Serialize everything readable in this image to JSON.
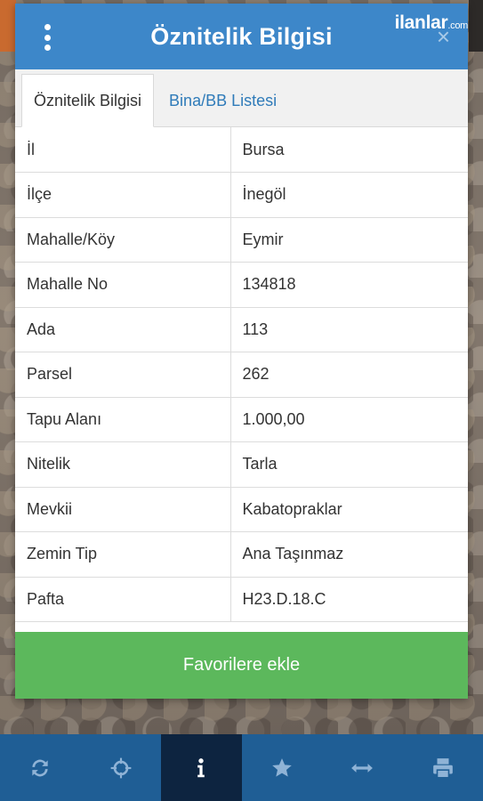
{
  "header": {
    "title": "Öznitelik Bilgisi",
    "brand": "ilanlar",
    "brand_suffix": ".com",
    "close_symbol": "×"
  },
  "tabs": [
    {
      "label": "Öznitelik Bilgisi",
      "active": true
    },
    {
      "label": "Bina/BB Listesi",
      "active": false
    }
  ],
  "attributes": [
    {
      "key": "İl",
      "value": "Bursa"
    },
    {
      "key": "İlçe",
      "value": "İnegöl"
    },
    {
      "key": "Mahalle/Köy",
      "value": "Eymir"
    },
    {
      "key": "Mahalle No",
      "value": "134818"
    },
    {
      "key": "Ada",
      "value": "113"
    },
    {
      "key": "Parsel",
      "value": "262"
    },
    {
      "key": "Tapu Alanı",
      "value": "1.000,00"
    },
    {
      "key": "Nitelik",
      "value": "Tarla"
    },
    {
      "key": "Mevkii",
      "value": "Kabatopraklar"
    },
    {
      "key": "Zemin Tip",
      "value": "Ana Taşınmaz"
    },
    {
      "key": "Pafta",
      "value": "H23.D.18.C"
    }
  ],
  "favorite_button": {
    "label": "Favorilere ekle"
  },
  "bottom_nav": [
    {
      "icon": "refresh-icon",
      "active": false
    },
    {
      "icon": "crosshair-icon",
      "active": false
    },
    {
      "icon": "info-icon",
      "active": true
    },
    {
      "icon": "star-icon",
      "active": false
    },
    {
      "icon": "measure-arrows-icon",
      "active": false
    },
    {
      "icon": "print-icon",
      "active": false
    }
  ],
  "colors": {
    "header_blue": "#3d87c9",
    "tab_link_blue": "#2f7bb9",
    "favorite_green": "#5cb85c",
    "bottom_bar": "#1f5e95",
    "bottom_bar_active": "#0d2440"
  }
}
